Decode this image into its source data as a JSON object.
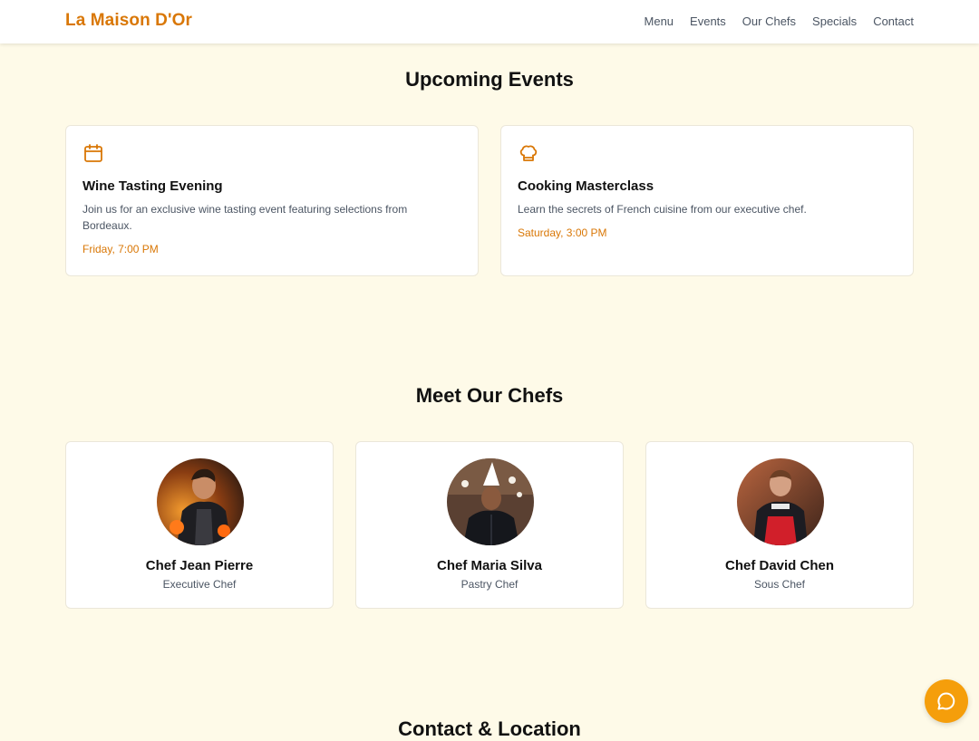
{
  "brand": "La Maison D'Or",
  "nav": [
    "Menu",
    "Events",
    "Our Chefs",
    "Specials",
    "Contact"
  ],
  "events_section": {
    "title": "Upcoming Events",
    "events": [
      {
        "icon": "calendar-icon",
        "title": "Wine Tasting Evening",
        "description": "Join us for an exclusive wine tasting event featuring selections from Bordeaux.",
        "time": "Friday, 7:00 PM"
      },
      {
        "icon": "chef-hat-icon",
        "title": "Cooking Masterclass",
        "description": "Learn the secrets of French cuisine from our executive chef.",
        "time": "Saturday, 3:00 PM"
      }
    ]
  },
  "chefs_section": {
    "title": "Meet Our Chefs",
    "chefs": [
      {
        "name": "Chef Jean Pierre",
        "role": "Executive Chef"
      },
      {
        "name": "Chef Maria Silva",
        "role": "Pastry Chef"
      },
      {
        "name": "Chef David Chen",
        "role": "Sous Chef"
      }
    ]
  },
  "contact_section": {
    "title": "Contact & Location"
  },
  "chat_button": {
    "icon": "chat-bubble-icon"
  },
  "colors": {
    "accent": "#d97706",
    "chat_button": "#f59e0b",
    "page_background": "#fefae8",
    "card_background": "#ffffff"
  }
}
